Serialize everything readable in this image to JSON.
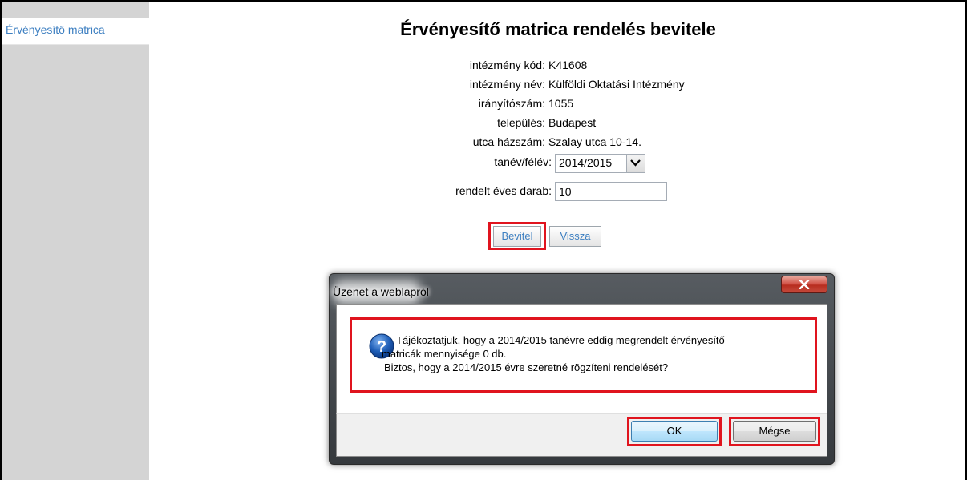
{
  "sidebar": {
    "items": [
      {
        "label": "Érvényesítő matrica"
      }
    ]
  },
  "page": {
    "title": "Érvényesítő matrica rendelés bevitele"
  },
  "form": {
    "fields": [
      {
        "label": "intézmény kód:",
        "value": "K41608"
      },
      {
        "label": "intézmény név:",
        "value": "Külföldi Oktatási Intézmény"
      },
      {
        "label": "irányítószám:",
        "value": "1055"
      },
      {
        "label": "település:",
        "value": "Budapest"
      },
      {
        "label": "utca házszám:",
        "value": "Szalay utca 10-14."
      }
    ],
    "year_label": "tanév/félév:",
    "year_value": "2014/2015",
    "qty_label": "rendelt éves darab:",
    "qty_value": "10",
    "submit_label": "Bevitel",
    "back_label": "Vissza"
  },
  "dialog": {
    "title": "Üzenet a weblapról",
    "message_lines": [
      "Tájékoztatjuk, hogy a 2014/2015 tanévre eddig megrendelt érvényesítő",
      "matricák mennyisége 0 db.",
      "Biztos, hogy a 2014/2015 évre szeretné rögzíteni rendelését?"
    ],
    "ok_label": "OK",
    "cancel_label": "Mégse",
    "icon": "question-icon"
  },
  "colors": {
    "highlight": "#e0141e",
    "link": "#3d7fc1",
    "sidebar_bg": "#d4d4d4"
  }
}
